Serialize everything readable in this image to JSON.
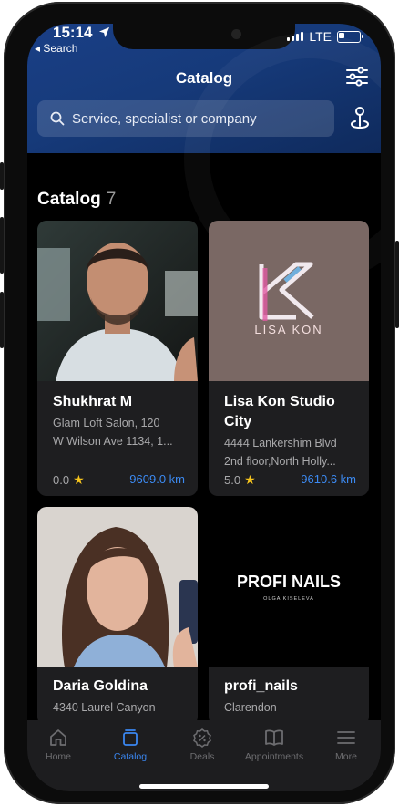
{
  "status": {
    "time": "15:14",
    "back": "◂ Search",
    "carrier": "LTE"
  },
  "header": {
    "title": "Catalog",
    "search_placeholder": "Service, specialist or company"
  },
  "section": {
    "title": "Catalog",
    "count": "7"
  },
  "cards": [
    {
      "name": "Shukhrat M",
      "address": [
        "Glam Loft Salon, 120",
        "W Wilson Ave 1134, 1..."
      ],
      "rating": "0.0",
      "distance": "9609.0 km"
    },
    {
      "name": "Lisa Kon Studio City",
      "address": [
        "4444 Lankershim Blvd",
        "2nd floor,North Holly..."
      ],
      "rating": "5.0",
      "distance": "9610.6 km",
      "logo_text": "LISA KON"
    },
    {
      "name": "Daria Goldina",
      "address": [
        "4340 Laurel Canyon"
      ]
    },
    {
      "name": "profi_nails",
      "address": [
        "Clarendon"
      ],
      "logo_main": "PROFI NAILS",
      "logo_sub": "OLGA KISELEVA"
    }
  ],
  "tabs": [
    {
      "label": "Home",
      "icon": "home-icon"
    },
    {
      "label": "Catalog",
      "icon": "catalog-icon",
      "active": true
    },
    {
      "label": "Deals",
      "icon": "deals-icon"
    },
    {
      "label": "Appointments",
      "icon": "appointments-icon"
    },
    {
      "label": "More",
      "icon": "menu-icon"
    }
  ],
  "colors": {
    "accent": "#3a86f0",
    "header": "#1a3f86",
    "star": "#f7c51d"
  }
}
